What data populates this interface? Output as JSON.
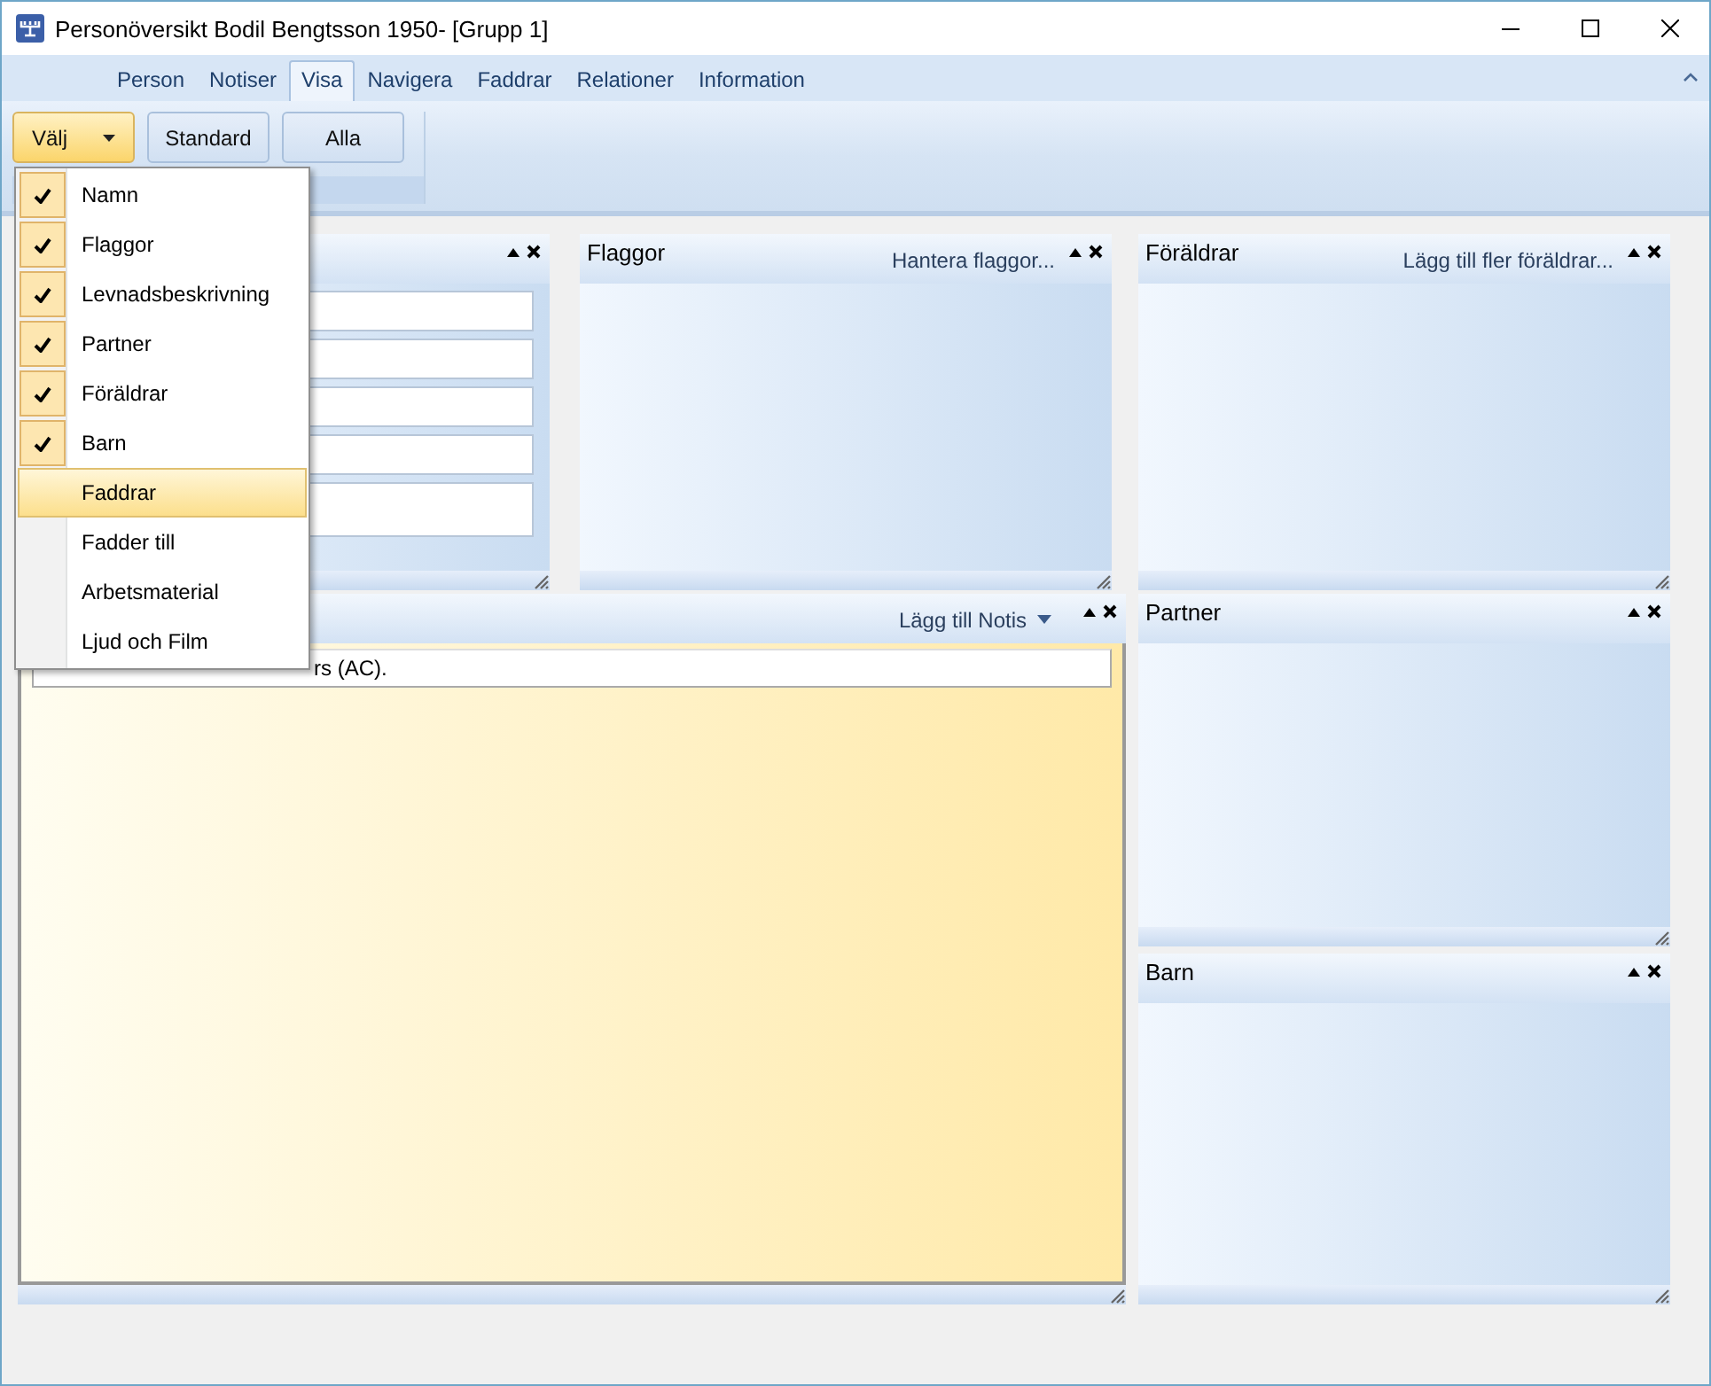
{
  "window": {
    "title": "Personöversikt Bodil Bengtsson 1950- [Grupp 1]"
  },
  "ribbon": {
    "tabs": [
      {
        "label": "Person",
        "selected": false
      },
      {
        "label": "Notiser",
        "selected": false
      },
      {
        "label": "Visa",
        "selected": true
      },
      {
        "label": "Navigera",
        "selected": false
      },
      {
        "label": "Faddrar",
        "selected": false
      },
      {
        "label": "Relationer",
        "selected": false
      },
      {
        "label": "Information",
        "selected": false
      }
    ],
    "buttons": [
      {
        "label": "Välj",
        "kind": "dropdown",
        "pressed": true
      },
      {
        "label": "Standard",
        "kind": "plain",
        "pressed": false
      },
      {
        "label": "Alla",
        "kind": "plain",
        "pressed": false
      }
    ]
  },
  "menu": {
    "items": [
      {
        "label": "Namn",
        "checked": true,
        "highlighted": false
      },
      {
        "label": "Flaggor",
        "checked": true,
        "highlighted": false
      },
      {
        "label": "Levnadsbeskrivning",
        "checked": true,
        "highlighted": false
      },
      {
        "label": "Partner",
        "checked": true,
        "highlighted": false
      },
      {
        "label": "Föräldrar",
        "checked": true,
        "highlighted": false
      },
      {
        "label": "Barn",
        "checked": true,
        "highlighted": false
      },
      {
        "label": "Faddrar",
        "checked": false,
        "highlighted": true
      },
      {
        "label": "Fadder till",
        "checked": false,
        "highlighted": false
      },
      {
        "label": "Arbetsmaterial",
        "checked": false,
        "highlighted": false
      },
      {
        "label": "Ljud och Film",
        "checked": false,
        "highlighted": false
      }
    ]
  },
  "panels": [
    {
      "kind": "name",
      "fields": [
        {
          "kind": "line"
        },
        {
          "kind": "line"
        },
        {
          "kind": "line"
        },
        {
          "kind": "line"
        },
        {
          "kind": "tall"
        }
      ]
    },
    {
      "kind": "flags",
      "title": "Flaggor",
      "action": "Hantera flaggor..."
    },
    {
      "kind": "parents",
      "title": "Föräldrar",
      "action": "Lägg till fler föräldrar..."
    },
    {
      "kind": "notes",
      "action": "Lägg till Notis",
      "note": "rs (AC)."
    },
    {
      "kind": "partner",
      "title": "Partner"
    },
    {
      "kind": "children",
      "title": "Barn"
    }
  ]
}
